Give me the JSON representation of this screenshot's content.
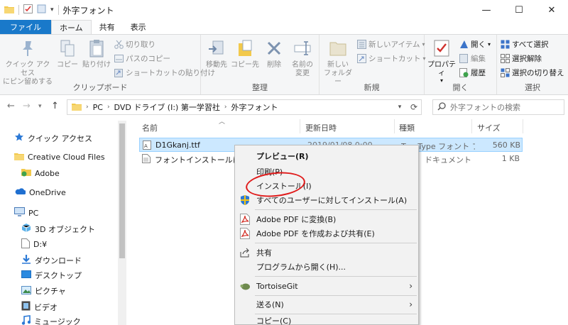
{
  "window": {
    "title": "外字フォント",
    "controls": {
      "minimize": "—",
      "maximize": "☐",
      "close": "✕"
    }
  },
  "ribbon_tabs": [
    "ファイル",
    "ホーム",
    "共有",
    "表示"
  ],
  "ribbon": {
    "clipboard": {
      "label": "クリップボード",
      "pin": "クイック アクセス\nにピン留めする",
      "copy": "コピー",
      "paste": "貼り付け",
      "cut": "切り取り",
      "copy_path": "パスのコピー",
      "paste_shortcut": "ショートカットの貼り付け"
    },
    "organize": {
      "label": "整理",
      "move_to": "移動先",
      "copy_to": "コピー先",
      "delete": "削除",
      "rename": "名前の\n変更"
    },
    "new": {
      "label": "新規",
      "new_folder": "新しい\nフォルダー",
      "new_item": "新しいアイテム",
      "shortcut": "ショートカット"
    },
    "open": {
      "label": "開く",
      "properties": "プロパティ",
      "open": "開く",
      "edit": "編集",
      "history": "履歴"
    },
    "select": {
      "label": "選択",
      "select_all": "すべて選択",
      "select_none": "選択解除",
      "invert": "選択の切り替え"
    }
  },
  "address": {
    "crumbs": [
      "PC",
      "DVD ドライブ (I:) 第一学習社",
      "外字フォント"
    ],
    "search_placeholder": "外字フォントの検索"
  },
  "navpane": [
    {
      "label": "クイック アクセス",
      "icon": "star-icon"
    },
    {
      "label": "Creative Cloud Files",
      "icon": "folder-icon"
    },
    {
      "label": "Adobe",
      "icon": "folder-icon"
    },
    {
      "label": "OneDrive",
      "icon": "cloud-icon"
    },
    {
      "label": "PC",
      "icon": "pc-icon"
    },
    {
      "label": "3D オブジェクト",
      "icon": "cube-icon"
    },
    {
      "label": "D:¥",
      "icon": "file-icon"
    },
    {
      "label": "ダウンロード",
      "icon": "download-icon"
    },
    {
      "label": "デスクトップ",
      "icon": "desktop-icon"
    },
    {
      "label": "ピクチャ",
      "icon": "picture-icon"
    },
    {
      "label": "ビデオ",
      "icon": "video-icon"
    },
    {
      "label": "ミュージック",
      "icon": "music-icon"
    }
  ],
  "columns": {
    "name": "名前",
    "date": "更新日時",
    "type": "種類",
    "size": "サイズ"
  },
  "files": [
    {
      "name": "D1Gkanj.ttf",
      "date": "2019/01/08 0:00",
      "type": "TrueType フォント フ...",
      "size": "560 KB"
    },
    {
      "name": "フォントインストールについて",
      "date": "",
      "type": "ドキュメント",
      "size": "1 KB"
    }
  ],
  "context_menu": {
    "preview": "プレビュー(R)",
    "print": "印刷(P)",
    "install": "インストール(I)",
    "install_all": "すべてのユーザーに対してインストール(A)",
    "pdf_convert": "Adobe PDF に変換(B)",
    "pdf_share": "Adobe PDF を作成および共有(E)",
    "share": "共有",
    "open_with": "プログラムから開く(H)...",
    "tortoise": "TortoiseGit",
    "send_to": "送る(N)",
    "copy": "コピー(C)"
  },
  "colors": {
    "file_tab": "#1979ca",
    "selection": "#cce8ff",
    "annotation": "#e01a1a"
  }
}
